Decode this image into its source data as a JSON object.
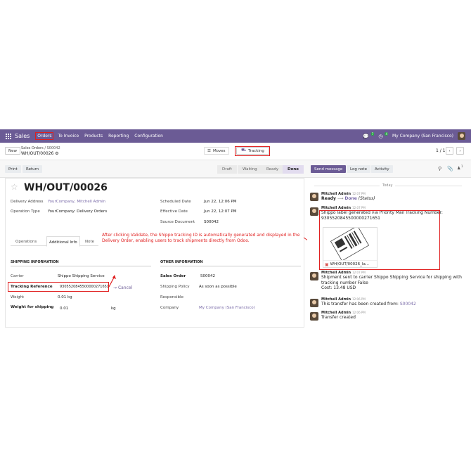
{
  "nav": {
    "app": "Sales",
    "menu": [
      "Orders",
      "To Invoice",
      "Products",
      "Reporting",
      "Configuration"
    ],
    "msg_count": "7",
    "activity_count": "4",
    "company": "My Company (San Francisco)"
  },
  "control": {
    "new_label": "New",
    "breadcrumb_parent": "Sales Orders",
    "breadcrumb_sep": "/",
    "breadcrumb_parent_ref": "S00042",
    "breadcrumb_current": "WH/OUT/00026",
    "moves_label": "Moves",
    "tracking_label": "Tracking",
    "pager": "1 / 1"
  },
  "actions": {
    "print": "Print",
    "return": "Return",
    "statuses": [
      "Draft",
      "Waiting",
      "Ready",
      "Done"
    ],
    "active_status": "Done"
  },
  "form": {
    "title": "WH/OUT/00026",
    "delivery_address_label": "Delivery Address",
    "delivery_address": "YourCompany, Mitchell Admin",
    "operation_type_label": "Operation Type",
    "operation_type": "YourCompany: Delivery Orders",
    "scheduled_date_label": "Scheduled Date",
    "scheduled_date": "Jun 22, 12:06 PM",
    "effective_date_label": "Effective Date",
    "effective_date": "Jun 22, 12:07 PM",
    "source_document_label": "Source Document",
    "source_document": "S00042",
    "tabs": [
      "Operations",
      "Additional Info",
      "Note"
    ],
    "shipping_info_header": "SHIPPING INFORMATION",
    "carrier_label": "Carrier",
    "carrier": "Shippo Shipping Service",
    "tracking_reference_label": "Tracking Reference",
    "tracking_reference": "9305520845500000271651",
    "cancel_label": "Cancel",
    "weight_label": "Weight",
    "weight": "0.01 kg",
    "weight_shipping_label": "Weight for shipping",
    "weight_shipping": "0.01",
    "weight_shipping_unit": "kg",
    "other_info_header": "OTHER INFORMATION",
    "sales_order_label": "Sales Order",
    "sales_order": "S00042",
    "shipping_policy_label": "Shipping Policy",
    "shipping_policy": "As soon as possible",
    "responsible_label": "Responsible",
    "company_label": "Company",
    "company": "My Company (San Francisco)"
  },
  "annotation": "After clicking Validate, the Shippo tracking ID is automatically generated and displayed in the Delivery Order, enabling users to track shipments directly from Odoo.",
  "chatter": {
    "send_message": "Send message",
    "log_note": "Log note",
    "activity": "Activity",
    "followers_count": "1",
    "day_separator": "Today",
    "messages": [
      {
        "author": "Mitchell Admin",
        "time": "12:07 PM",
        "status_from": "Ready",
        "status_to": "Done",
        "status_suffix": "(Status)"
      },
      {
        "author": "Mitchell Admin",
        "time": "12:07 PM",
        "body": "Shippo label generated via Priority Mail Tracking Number: 9305520845500000271651",
        "attachment": "WH/OUT/00026_la..."
      },
      {
        "author": "Mitchell Admin",
        "time": "12:07 PM",
        "body": "Shipment sent to carrier Shippo Shipping Service for shipping with tracking number False",
        "cost": "Cost: 13.48 USD"
      },
      {
        "author": "Mitchell Admin",
        "time": "12:06 PM",
        "body": "This transfer has been created from:",
        "link": "S00042"
      },
      {
        "author": "Mitchell Admin",
        "time": "12:06 PM",
        "body": "Transfer created"
      }
    ]
  }
}
